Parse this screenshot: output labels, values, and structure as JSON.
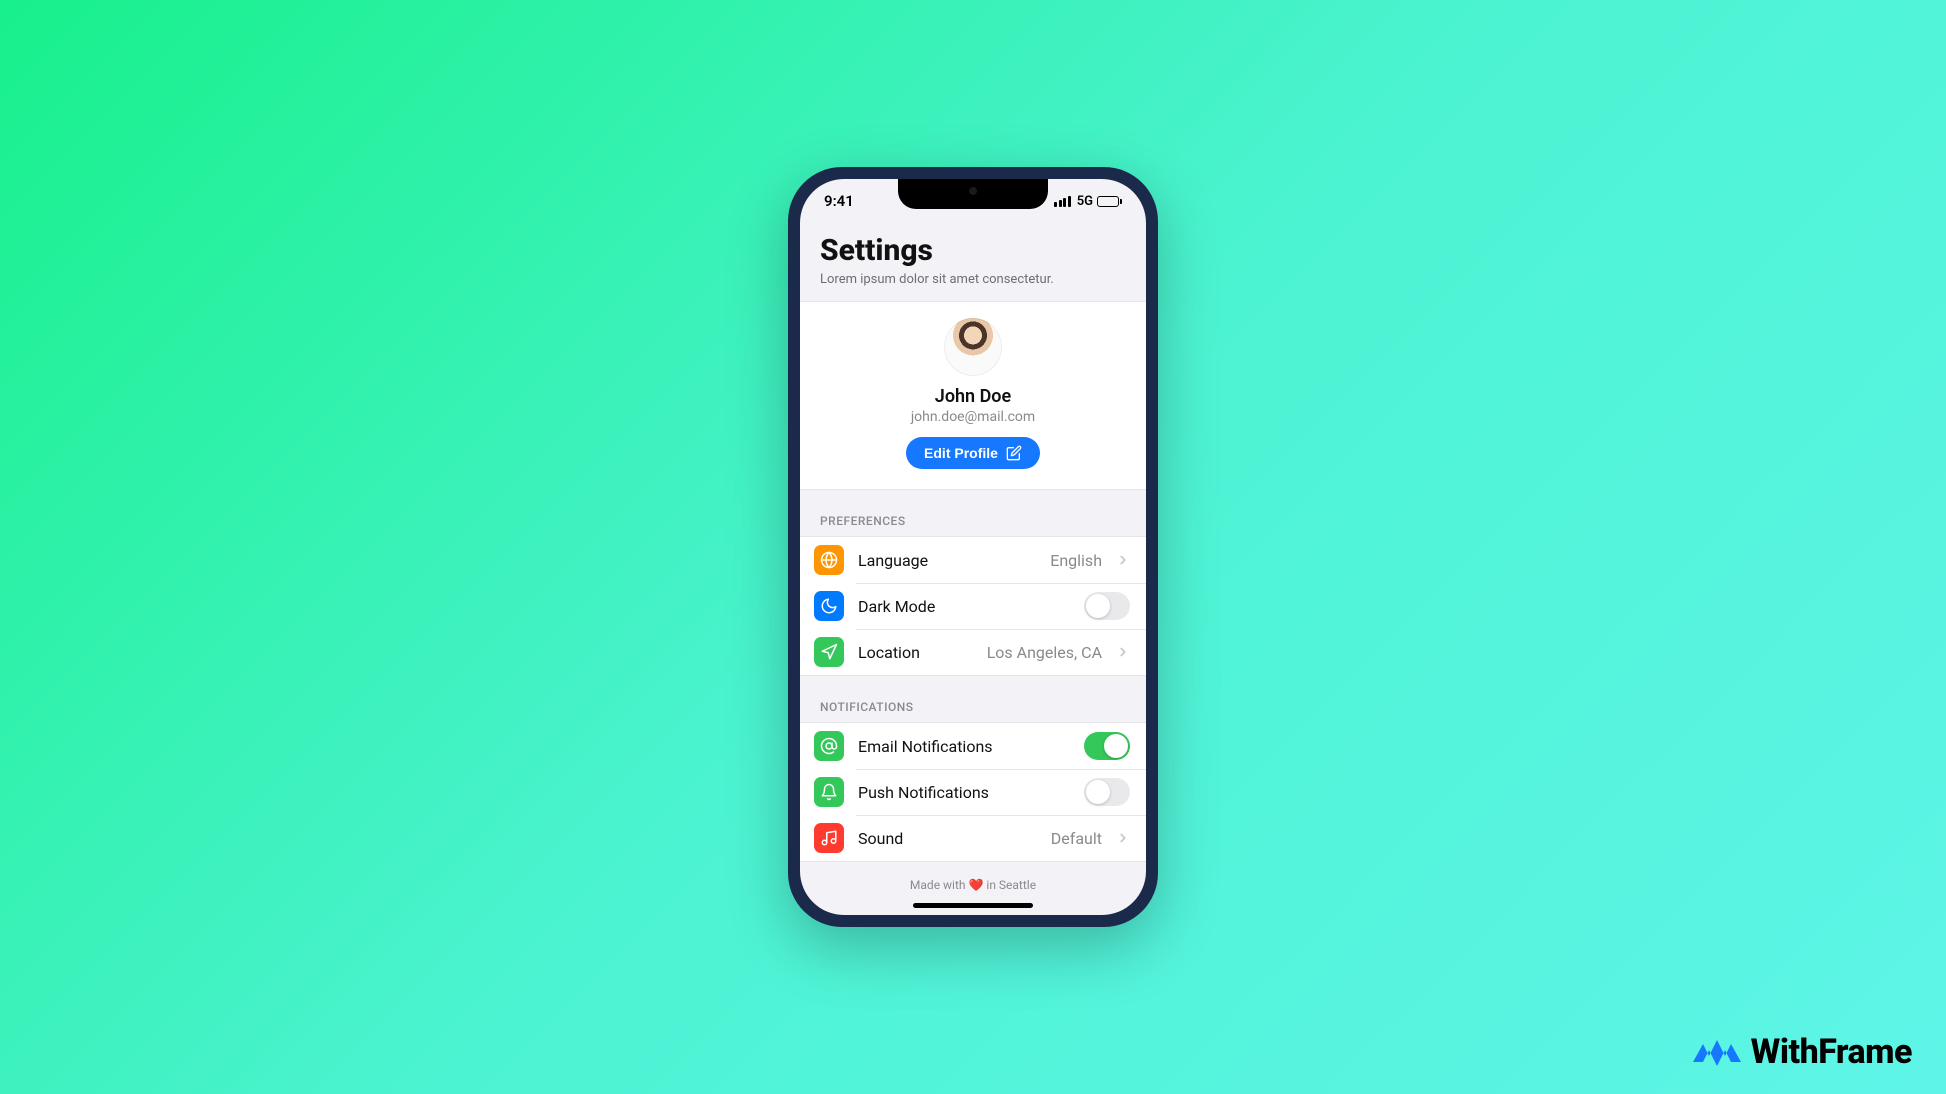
{
  "status_bar": {
    "time": "9:41",
    "network": "5G"
  },
  "header": {
    "title": "Settings",
    "subtitle": "Lorem ipsum dolor sit amet consectetur."
  },
  "profile": {
    "name": "John Doe",
    "email": "john.doe@mail.com",
    "edit_label": "Edit Profile"
  },
  "sections": {
    "preferences": {
      "label": "PREFERENCES",
      "rows": {
        "language": {
          "label": "Language",
          "value": "English",
          "icon_color": "#ff9500"
        },
        "dark_mode": {
          "label": "Dark Mode",
          "on": false,
          "icon_color": "#007aff"
        },
        "location": {
          "label": "Location",
          "value": "Los Angeles, CA",
          "icon_color": "#34c759"
        }
      }
    },
    "notifications": {
      "label": "NOTIFICATIONS",
      "rows": {
        "email": {
          "label": "Email Notifications",
          "on": true,
          "icon_color": "#34c759"
        },
        "push": {
          "label": "Push Notifications",
          "on": false,
          "icon_color": "#34c759"
        },
        "sound": {
          "label": "Sound",
          "value": "Default",
          "icon_color": "#ff3b30"
        }
      }
    }
  },
  "footer_note": "Made with ❤️ in Seattle",
  "brand": "WithFrame"
}
